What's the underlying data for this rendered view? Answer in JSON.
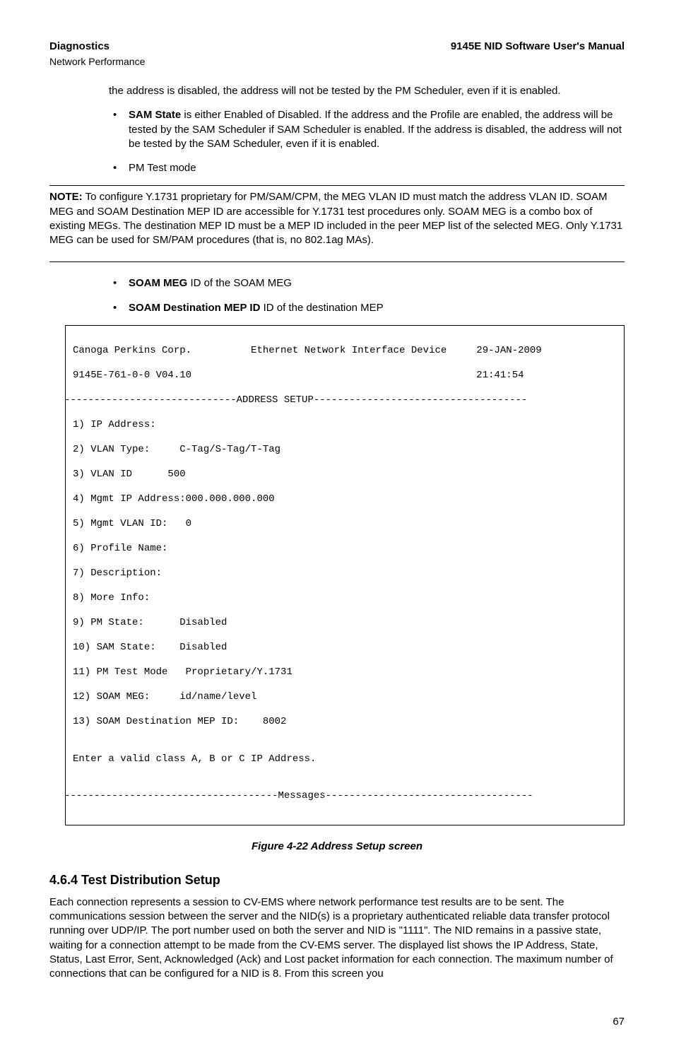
{
  "header": {
    "left": "Diagnostics",
    "right": "9145E NID Software User's Manual",
    "sub": "Network Performance"
  },
  "frag_para": "the address is disabled, the address will not be tested by the PM Scheduler, even if it is enabled.",
  "bullets1": [
    {
      "bold": "SAM State",
      "text": " is either Enabled of Disabled. If the address and the Profile are enabled, the address will be tested by the SAM Scheduler if SAM Scheduler is enabled. If the address is disabled, the address will not be tested by the SAM Scheduler, even if it is enabled."
    },
    {
      "bold": "",
      "text": "PM Test mode"
    }
  ],
  "note": {
    "lead": "NOTE:",
    "text": "  To configure Y.1731 proprietary for PM/SAM/CPM, the MEG VLAN ID must match the address VLAN ID. SOAM MEG and SOAM Destination MEP ID are accessible for Y.1731 test procedures only.  SOAM MEG  is a combo box of existing MEGs. The destination MEP ID must be a MEP ID included in the peer MEP list of the selected MEG. Only Y.1731 MEG can be used for SM/PAM procedures (that is, no 802.1ag MAs)."
  },
  "bullets2": [
    {
      "bold": "SOAM MEG",
      "text": "  ID of the SOAM MEG"
    },
    {
      "bold": "SOAM Destination MEP ID",
      "text": "    ID of the destination MEP"
    }
  ],
  "terminal": {
    "l0": "Canoga Perkins Corp.          Ethernet Network Interface Device     29-JAN-2009",
    "l1": "9145E-761-0-0 V04.10                                                21:41:54",
    "l2": "-----------------------------ADDRESS SETUP------------------------------------",
    "l3": "1) IP Address:",
    "l4": "2) VLAN Type:     C-Tag/S-Tag/T-Tag",
    "l5": "3) VLAN ID      500",
    "l6": "4) Mgmt IP Address:000.000.000.000",
    "l7": "5) Mgmt VLAN ID:   0",
    "l8": "6) Profile Name:",
    "l9": "7) Description:",
    "l10": "8) More Info:",
    "l11": "9) PM State:      Disabled",
    "l12": "10) SAM State:    Disabled",
    "l13": "11) PM Test Mode   Proprietary/Y.1731",
    "l14": "12) SOAM MEG:     id/name/level",
    "l15": "13) SOAM Destination MEP ID:    8002",
    "l16": "",
    "l17": "Enter a valid class A, B or C IP Address.",
    "l18": "",
    "l19": "------------------------------------Messages-----------------------------------"
  },
  "figure_caption": "Figure 4-22  Address Setup screen",
  "section_heading": "4.6.4  Test Distribution Setup",
  "section_body": "Each connection represents a session to CV-EMS where network performance test results are to be sent. The communications session between the server and the NID(s) is a proprietary authenticated reliable data transfer protocol running over UDP/IP. The port number used on both the server and NID is \"1111\". The NID remains in a passive state, waiting for a connection attempt to be made from the CV-EMS server. The displayed list shows the IP Address, State, Status, Last Error, Sent, Acknowledged (Ack) and Lost packet information for each connection. The maximum number of connections that can be configured for a NID is 8. From this screen you",
  "page_number": "67"
}
